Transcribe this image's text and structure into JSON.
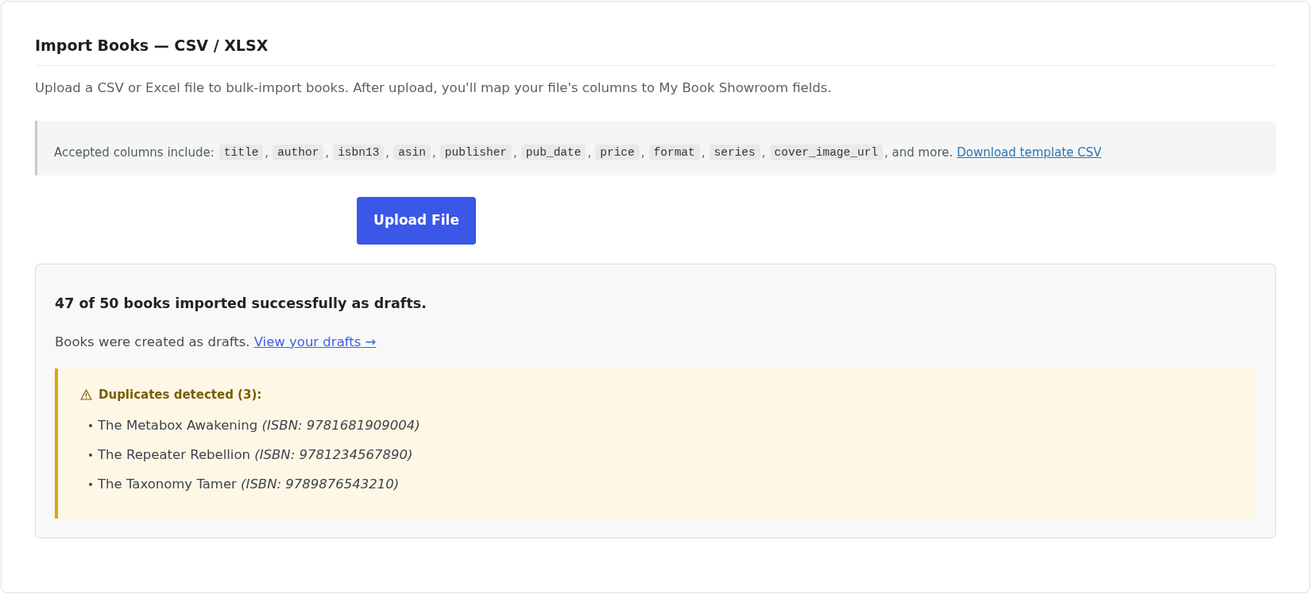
{
  "page": {
    "title": "Import Books — CSV / XLSX",
    "description": "Upload a CSV or Excel file to bulk-import books. After upload, you'll map your file's columns to My Book Showroom fields."
  },
  "accepted_columns": {
    "label": "Accepted columns include:",
    "columns": [
      {
        "name": "title",
        "after": ","
      },
      {
        "name": "author",
        "after": ","
      },
      {
        "name": "isbn13",
        "after": ","
      },
      {
        "name": "asin",
        "after": ","
      },
      {
        "name": "publisher",
        "after": ","
      },
      {
        "name": "pub_date",
        "after": ","
      },
      {
        "name": "price",
        "after": ","
      },
      {
        "name": "format",
        "after": ","
      },
      {
        "name": "series",
        "after": ","
      },
      {
        "name": "cover_image_url",
        "after": ", and more."
      }
    ],
    "link": "Download template CSV"
  },
  "upload_button": {
    "label": "Upload File"
  },
  "result": {
    "summary": "47 of 50 books imported successfully as drafts.",
    "note": "Books were created as drafts.",
    "link": "View your drafts →",
    "warning": {
      "heading": "Duplicates detected (3):",
      "items": [
        "The Metabox Awakening *(ISBN: 9781681909004)*",
        "The Repeater Rebellion *(ISBN: 9781234567890)*",
        "The Taxonomy Tamer *(ISBN: 9789876543210)*"
      ]
    }
  }
}
